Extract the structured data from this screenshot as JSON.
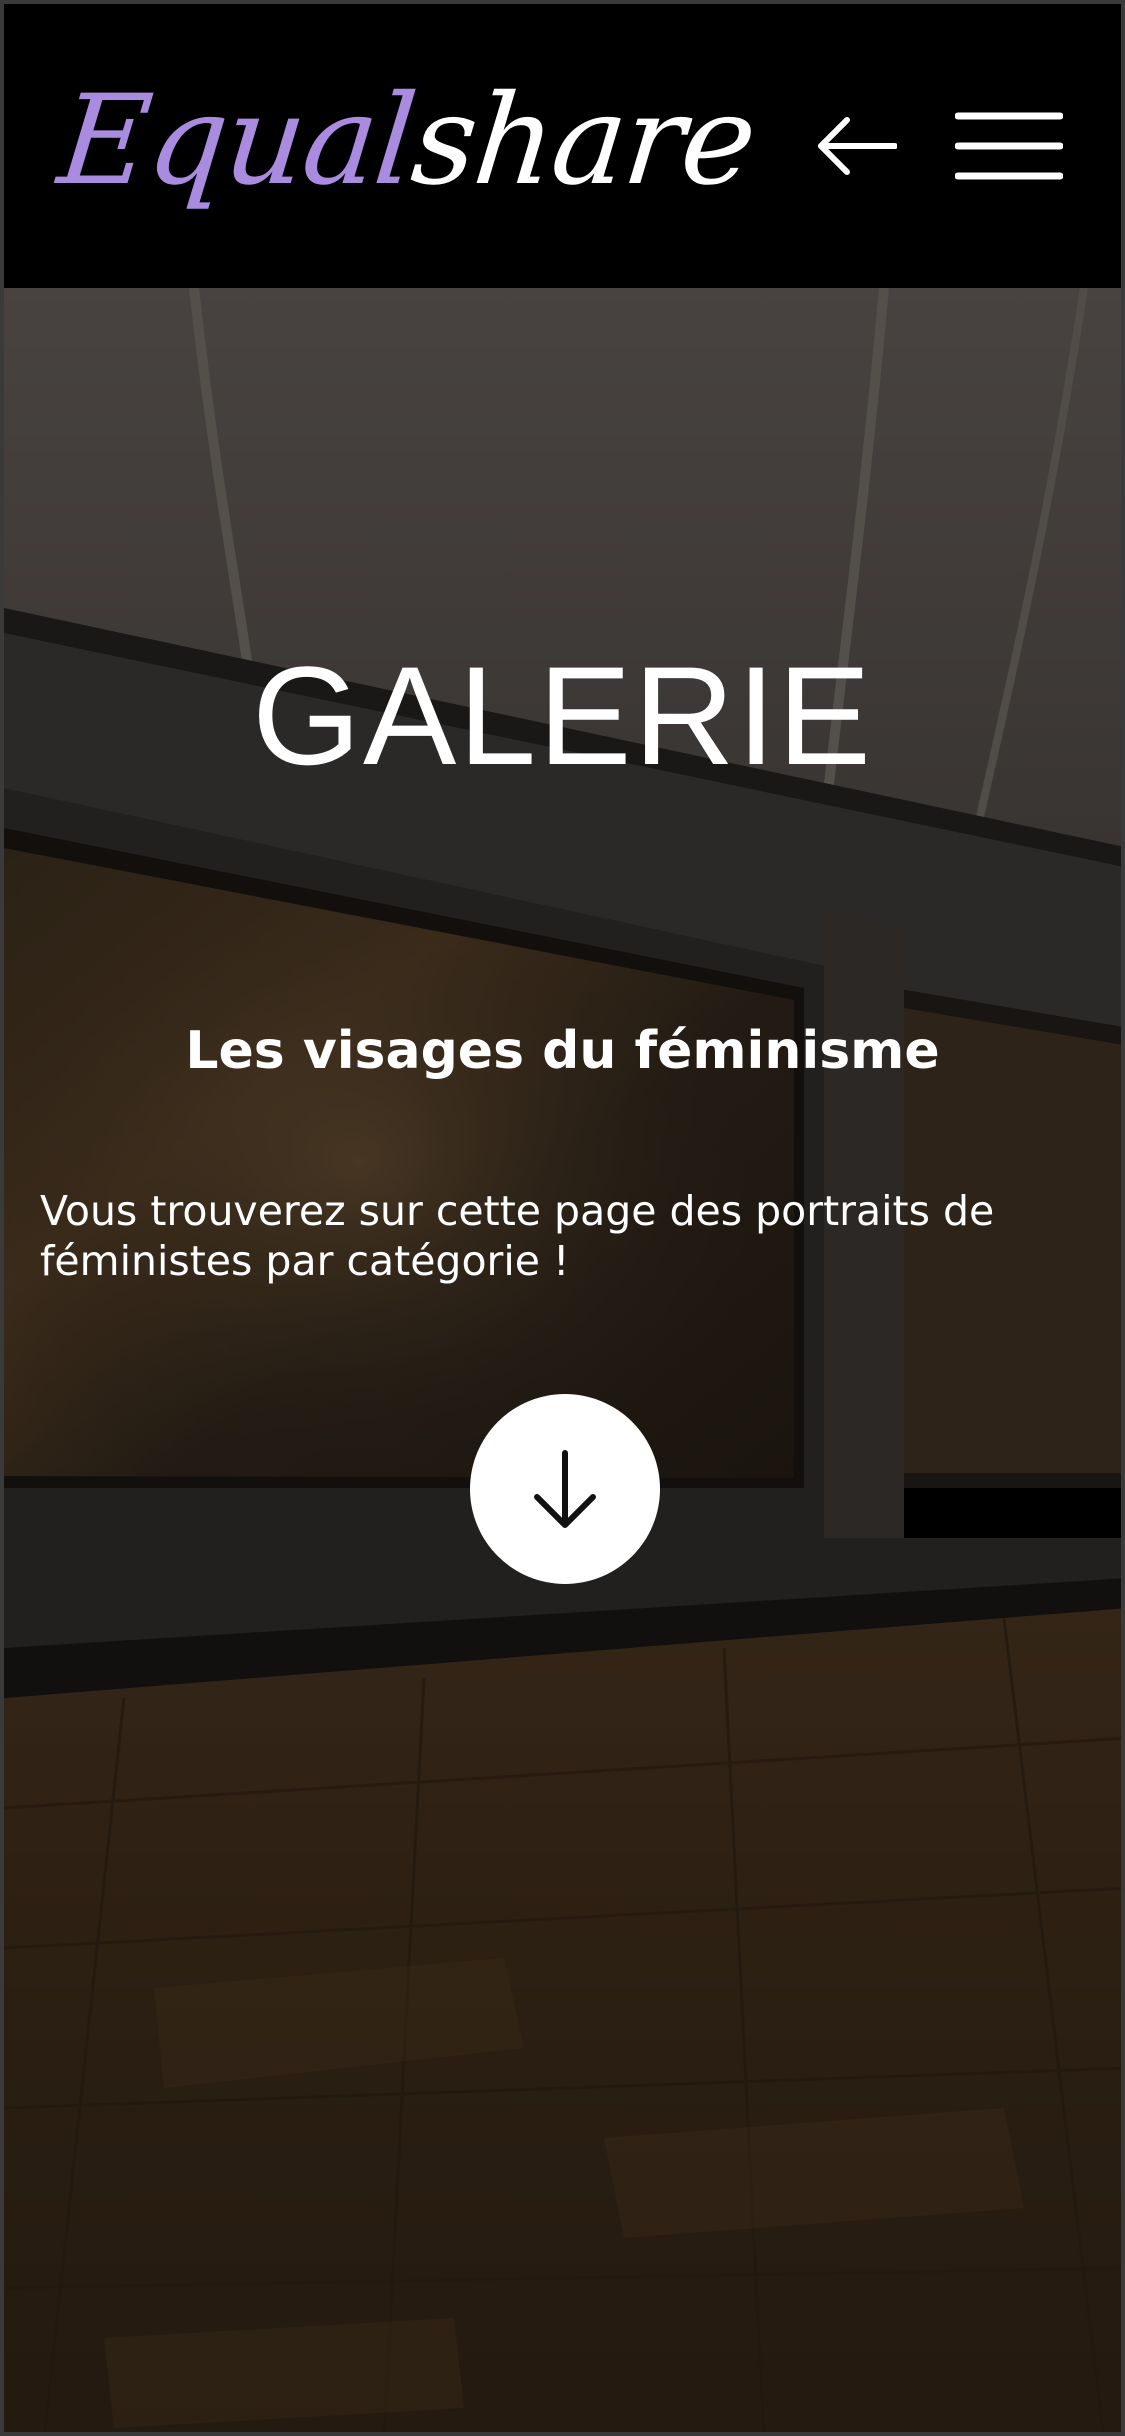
{
  "header": {
    "logo_part1": "Equal",
    "logo_part2": "share",
    "back_icon": "arrow-left-icon",
    "menu_icon": "hamburger-menu-icon"
  },
  "hero": {
    "title": "GALERIE",
    "subtitle": "Les visages du féminisme",
    "text": "Vous trouverez sur cette page des portraits de féministes par catégorie !",
    "scroll_icon": "arrow-down-icon"
  },
  "colors": {
    "logo_accent": "#a98be0",
    "header_bg": "#000000",
    "text": "#ffffff"
  }
}
